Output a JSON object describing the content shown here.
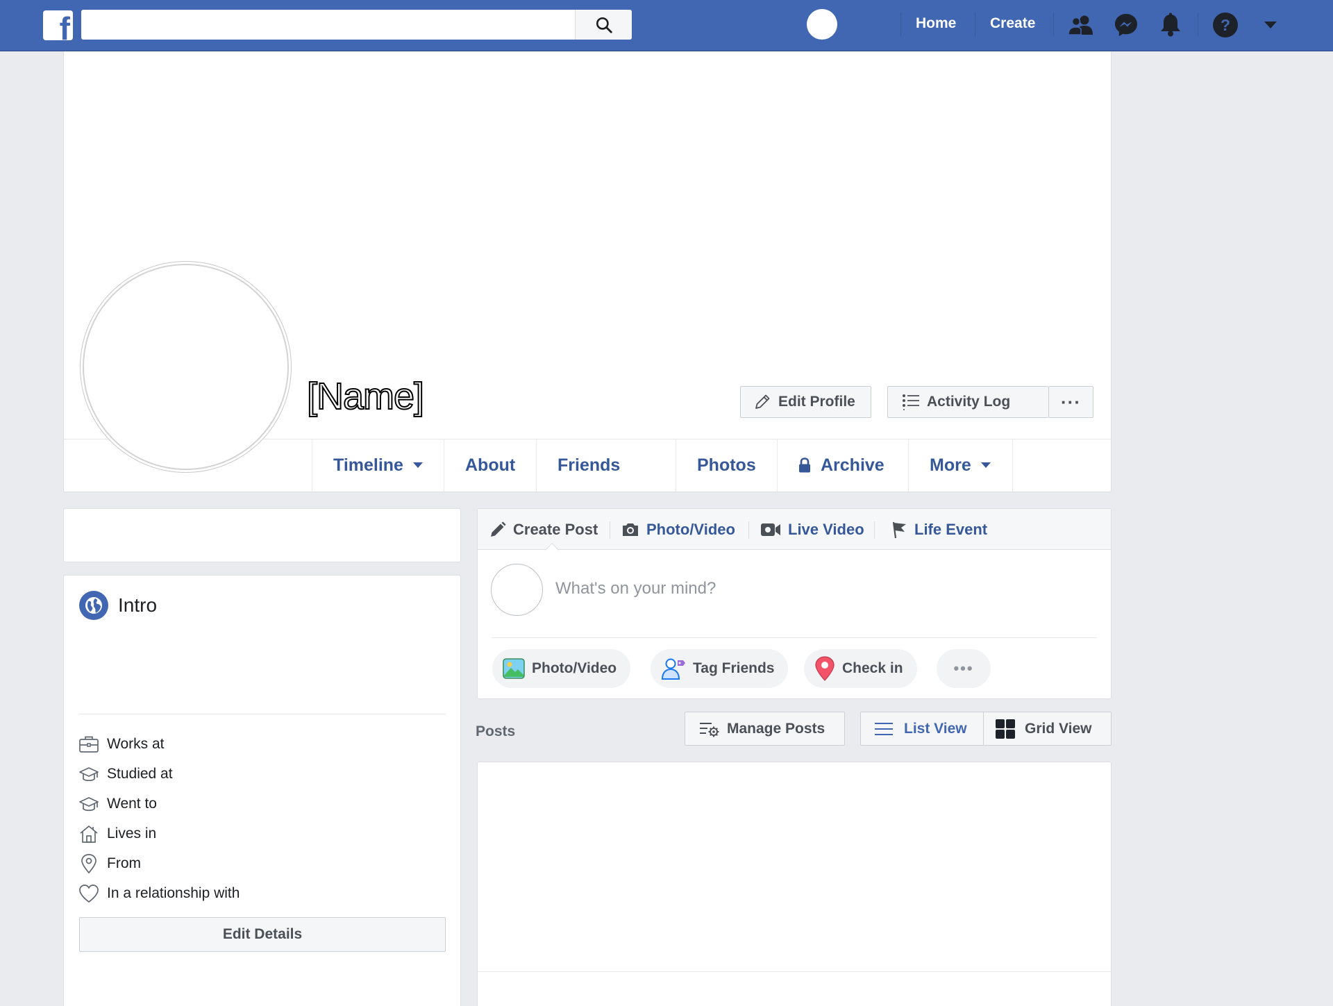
{
  "topbar": {
    "logo_letter": "f",
    "search": {
      "value": "",
      "placeholder": ""
    },
    "links": {
      "home": "Home",
      "create": "Create"
    },
    "icons": [
      "friends-icon",
      "messenger-icon",
      "notifications-icon",
      "help-icon",
      "account-menu-icon"
    ]
  },
  "profile": {
    "name": "[Name]",
    "buttons": {
      "edit_profile": "Edit Profile",
      "activity_log": "Activity Log",
      "more_dots": "···"
    },
    "tabs": [
      "Timeline",
      "About",
      "Friends",
      "Photos",
      "Archive",
      "More"
    ]
  },
  "intro": {
    "title": "Intro",
    "details": [
      "Works at",
      "Studied at",
      "Went to",
      "Lives in",
      "From",
      "In a relationship with"
    ],
    "edit_details": "Edit Details"
  },
  "composer": {
    "tabs": [
      "Create Post",
      "Photo/Video",
      "Live Video",
      "Life Event"
    ],
    "placeholder": "What's on your mind?",
    "actions": [
      "Photo/Video",
      "Tag Friends",
      "Check in",
      "•••"
    ]
  },
  "posts": {
    "label": "Posts",
    "manage_posts": "Manage Posts",
    "list_view": "List View",
    "grid_view": "Grid View"
  },
  "colors": {
    "brand_blue": "#4267b2",
    "link_blue": "#365899",
    "page_bg": "#e9ebee",
    "button_text": "#4b4f56"
  }
}
